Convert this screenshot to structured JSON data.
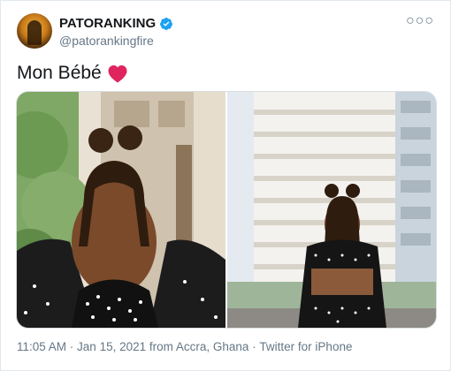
{
  "tweet": {
    "author_name": "PATORANKING",
    "author_handle": "@patorankingfire",
    "verified_icon": "verified-badge-icon",
    "more_icon": "more-options-icon",
    "text": "Mon Bébé",
    "emoji": "heart-icon",
    "time": "11:05 AM",
    "separator1": " · ",
    "date": "Jan 15, 2021 from Accra, Ghana",
    "separator2": " · ",
    "source": "Twitter for iPhone"
  },
  "colors": {
    "accent": "#1da1f2",
    "heart": "#e0245e",
    "text": "#14171a",
    "muted": "#657786"
  }
}
